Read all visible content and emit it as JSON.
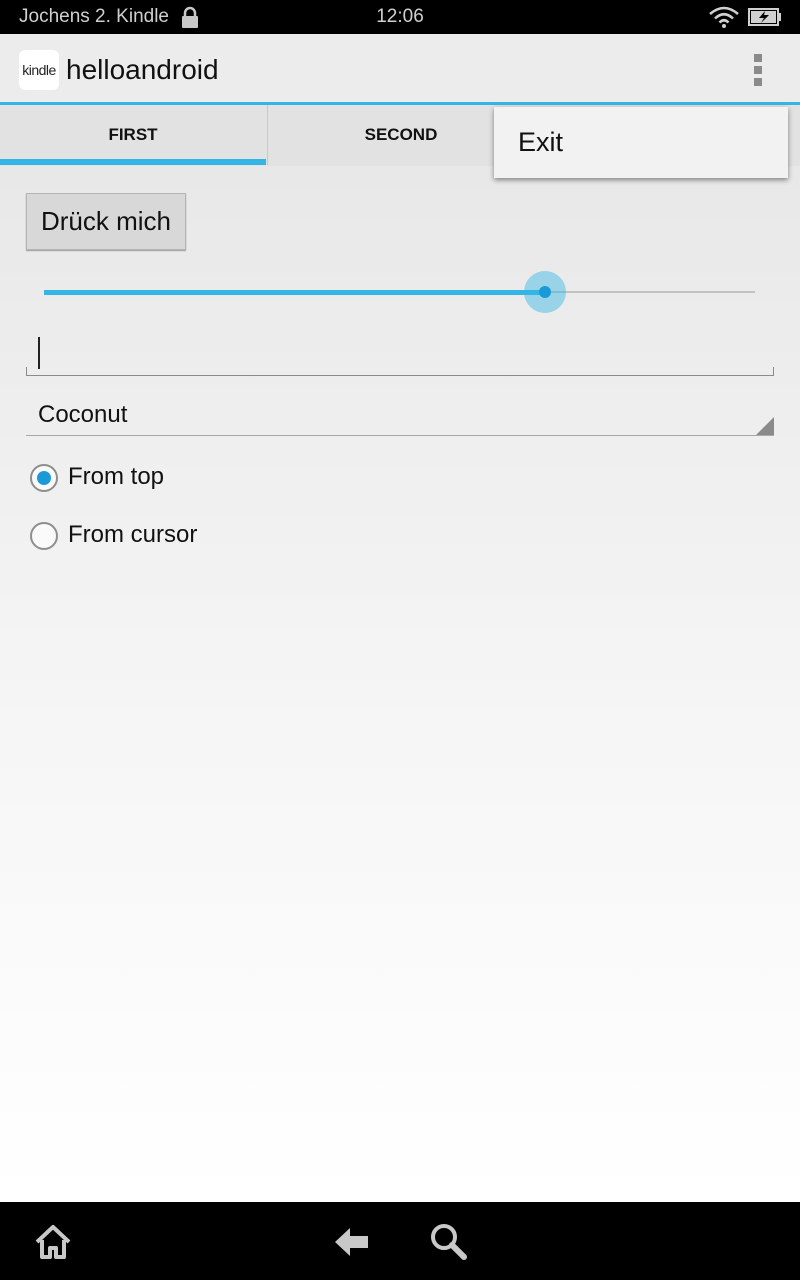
{
  "status_bar": {
    "device_name": "Jochens 2. Kindle",
    "time": "12:06",
    "icons": [
      "lock-icon",
      "wifi-icon",
      "battery-charging-icon"
    ]
  },
  "action_bar": {
    "app_icon_text": "kindle",
    "title": "helloandroid",
    "overflow_icon": "overflow-menu-icon"
  },
  "tabs": [
    {
      "label": "FIRST",
      "selected": true
    },
    {
      "label": "SECOND",
      "selected": false
    }
  ],
  "main": {
    "button_label": "Drück mich",
    "seekbar": {
      "value_fraction": 0.705
    },
    "edit_text": {
      "value": "",
      "placeholder": ""
    },
    "spinner": {
      "selected": "Coconut"
    },
    "radio_options": [
      {
        "label": "From top",
        "checked": true
      },
      {
        "label": "From cursor",
        "checked": false
      }
    ]
  },
  "overflow_menu": {
    "items": [
      {
        "label": "Exit"
      }
    ]
  },
  "nav_bar": {
    "icons": [
      "home-icon",
      "back-icon",
      "search-icon"
    ]
  },
  "colors": {
    "accent": "#33b5e5",
    "accent_dark": "#1a9bd7",
    "action_bar_bg": "#ececec",
    "tab_bar_bg": "#e2e2e2",
    "system_bar_bg": "#000000"
  }
}
